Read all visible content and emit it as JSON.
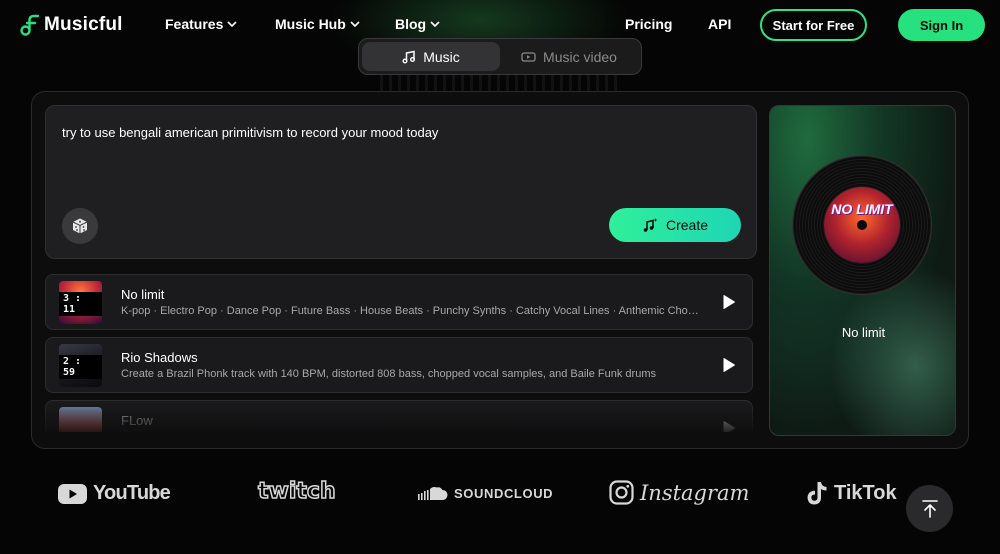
{
  "brand": {
    "name": "Musicful",
    "accent": "#27e07e"
  },
  "nav": {
    "features": "Features",
    "music_hub": "Music Hub",
    "blog": "Blog",
    "pricing": "Pricing",
    "api": "API",
    "start_free": "Start for Free",
    "sign_in": "Sign In"
  },
  "mode_tabs": [
    {
      "label": "Music",
      "icon": "music-note-icon",
      "active": true
    },
    {
      "label": "Music video",
      "icon": "video-icon",
      "active": false
    }
  ],
  "prompt": {
    "text": "try to use bengali american primitivism to record your mood today",
    "create_label": "Create"
  },
  "tracks": [
    {
      "title": "No limit",
      "description": "K-pop · Electro Pop · Dance Pop · Future Bass · House Beats · Punchy Synths · Catchy Vocal Lines · Anthemic Chorus",
      "duration": "3 : 11"
    },
    {
      "title": "Rio Shadows",
      "description": "Create a Brazil Phonk track with 140 BPM, distorted 808 bass, chopped vocal samples, and Baile Funk drums",
      "duration": "2 : 59"
    },
    {
      "title": "FLow",
      "description": "",
      "duration": ""
    }
  ],
  "preview": {
    "cover_title": "NO LIMIT",
    "track_name": "No limit"
  },
  "brands": [
    {
      "name": "YouTube",
      "icon": "youtube-icon"
    },
    {
      "name": "twitch",
      "icon": "twitch-logo"
    },
    {
      "name": "SOUNDCLOUD",
      "icon": "soundcloud-icon"
    },
    {
      "name": "Instagram",
      "icon": "instagram-icon"
    },
    {
      "name": "TikTok",
      "icon": "tiktok-icon"
    }
  ]
}
